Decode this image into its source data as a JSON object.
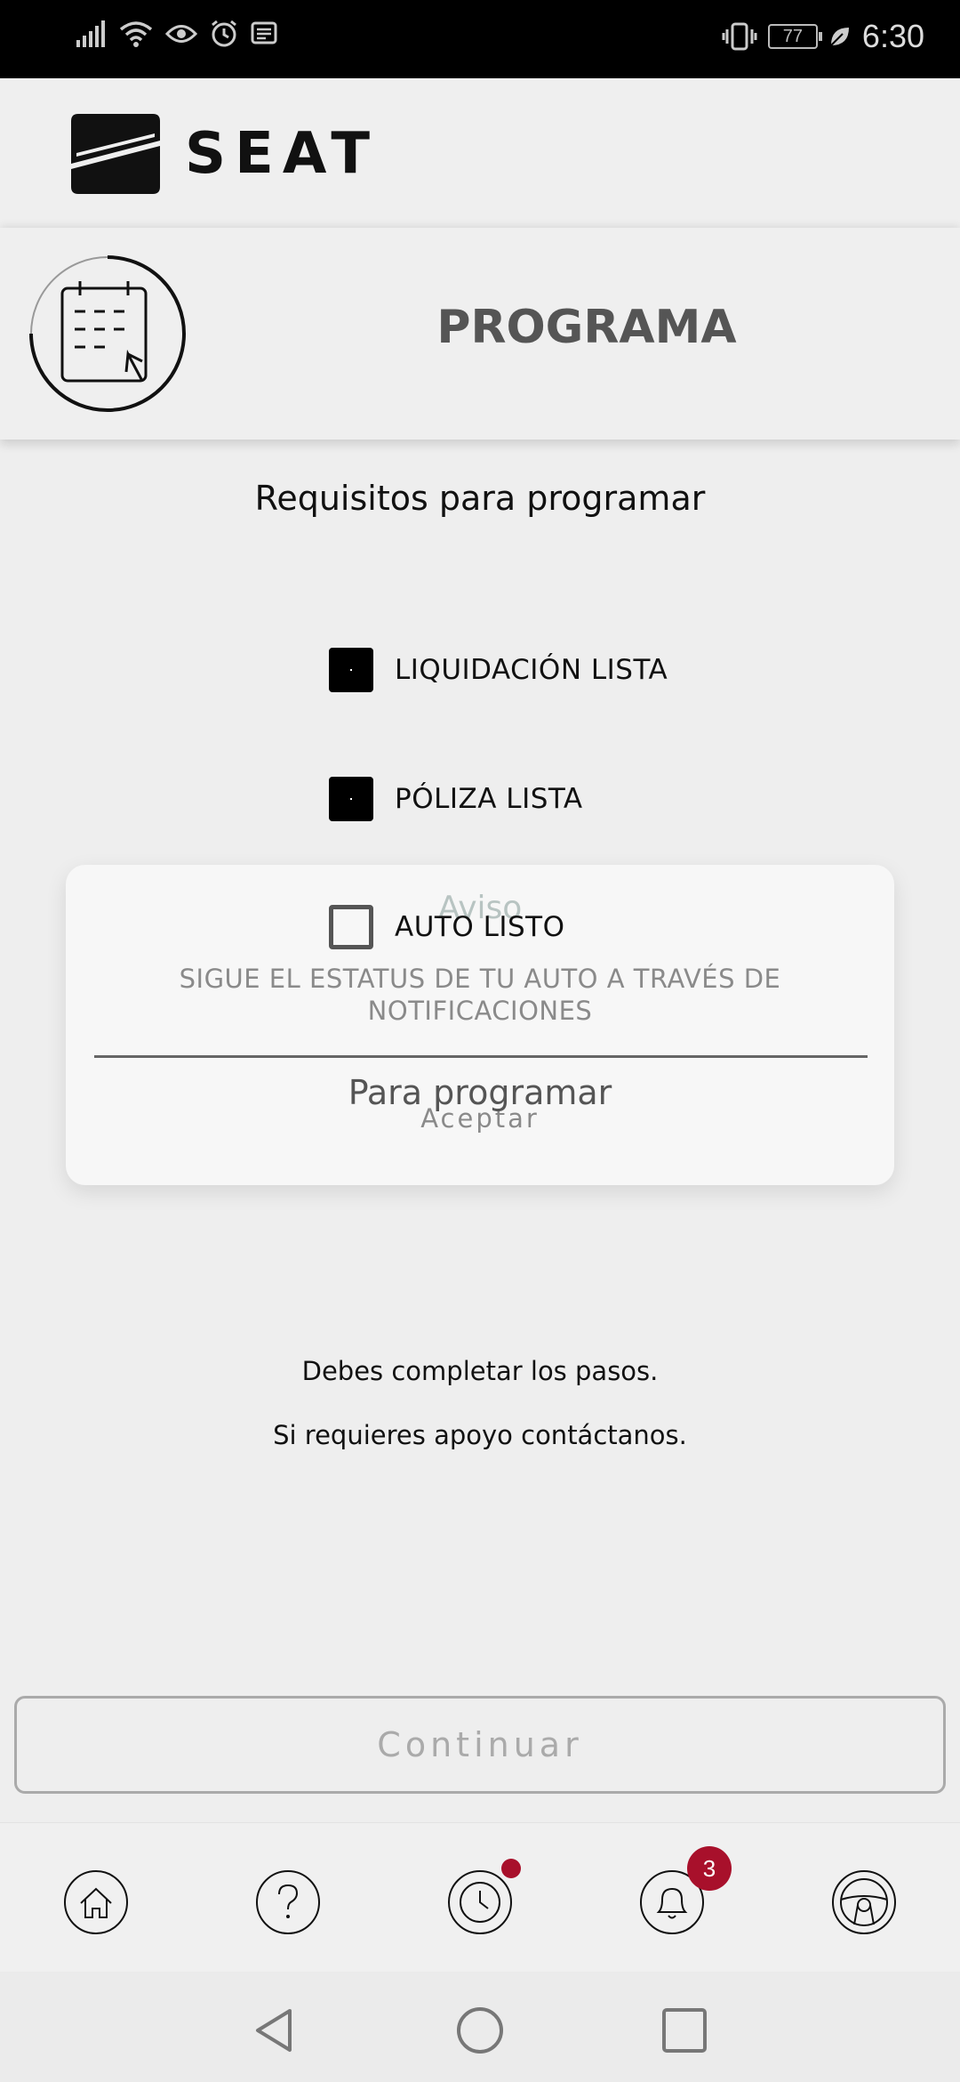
{
  "status_bar": {
    "time": "6:30",
    "battery": "77",
    "icons": [
      "signal-icon",
      "wifi-icon",
      "eye-icon",
      "alarm-icon",
      "message-icon",
      "vibrate-icon",
      "battery-icon",
      "leaf-icon"
    ]
  },
  "header": {
    "brand": "SEAT"
  },
  "page": {
    "title": "PROGRAMA",
    "icon": "calendar-click-icon",
    "requirements_title": "Requisitos para programar"
  },
  "requirements": [
    {
      "label": "LIQUIDACIÓN LISTA",
      "checked": true
    },
    {
      "label": "PÓLIZA LISTA",
      "checked": true
    },
    {
      "label": "AUTO LISTO",
      "checked": false
    }
  ],
  "dialog": {
    "title": "Aviso",
    "message": "SIGUE EL ESTATUS DE TU AUTO A TRAVÉS DE NOTIFICACIONES",
    "accept_label": "Aceptar"
  },
  "section_label": "Para programar",
  "info": {
    "line1": "Debes completar los pasos.",
    "line2": "Si requieres apoyo contáctanos."
  },
  "continue_label": "Continuar",
  "bottom_nav": {
    "items": [
      "home-icon",
      "help-icon",
      "clock-icon",
      "bell-icon",
      "steering-wheel-icon"
    ],
    "notification_count": "3",
    "accent": "#a8102b"
  },
  "system_nav": [
    "back-icon",
    "home-circle-icon",
    "recents-icon"
  ]
}
